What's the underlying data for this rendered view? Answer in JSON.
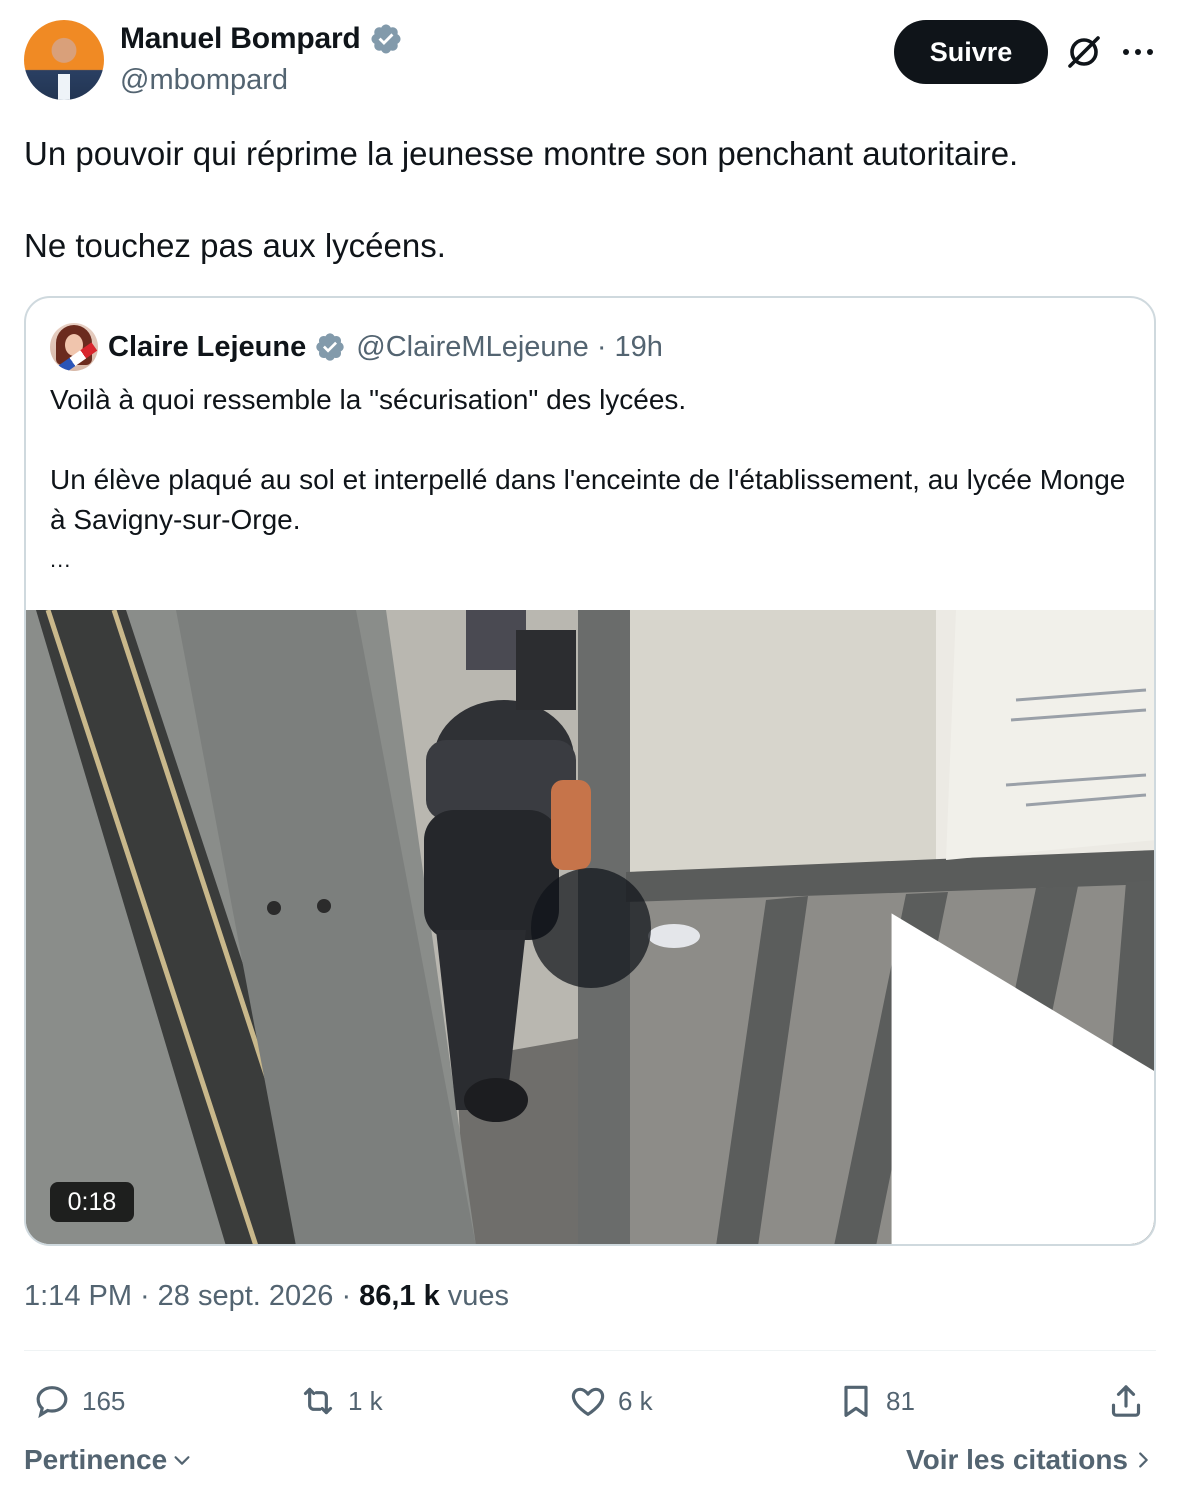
{
  "author": {
    "display_name": "Manuel Bompard",
    "handle": "@mbompard"
  },
  "follow_label": "Suivre",
  "tweet": {
    "line1": "Un pouvoir qui réprime la jeunesse montre son penchant autoritaire.",
    "line2": "Ne touchez pas aux lycéens."
  },
  "quote": {
    "display_name": "Claire Lejeune",
    "handle": "@ClaireMLejeune",
    "separator": "·",
    "time": "19h",
    "text1": "Voilà à quoi ressemble la \"sécurisation\" des lycées.",
    "text2": "Un élève plaqué au sol et interpellé dans l'enceinte de l'établissement, au lycée Monge à Savigny-sur-Orge.",
    "more": "...",
    "video_duration": "0:18"
  },
  "meta": {
    "time": "1:14 PM",
    "sep1": "·",
    "date": "28 sept. 2026",
    "sep2": "·",
    "views_count": "86,1 k",
    "views_label": "vues"
  },
  "actions": {
    "replies": "165",
    "reposts": "1 k",
    "likes": "6 k",
    "bookmarks": "81"
  },
  "footer": {
    "sort_label": "Pertinence",
    "quotes_link": "Voir les citations"
  },
  "colors": {
    "text": "#0f1419",
    "secondary": "#536471",
    "verified": "#829aab",
    "border": "#cfd9de"
  }
}
